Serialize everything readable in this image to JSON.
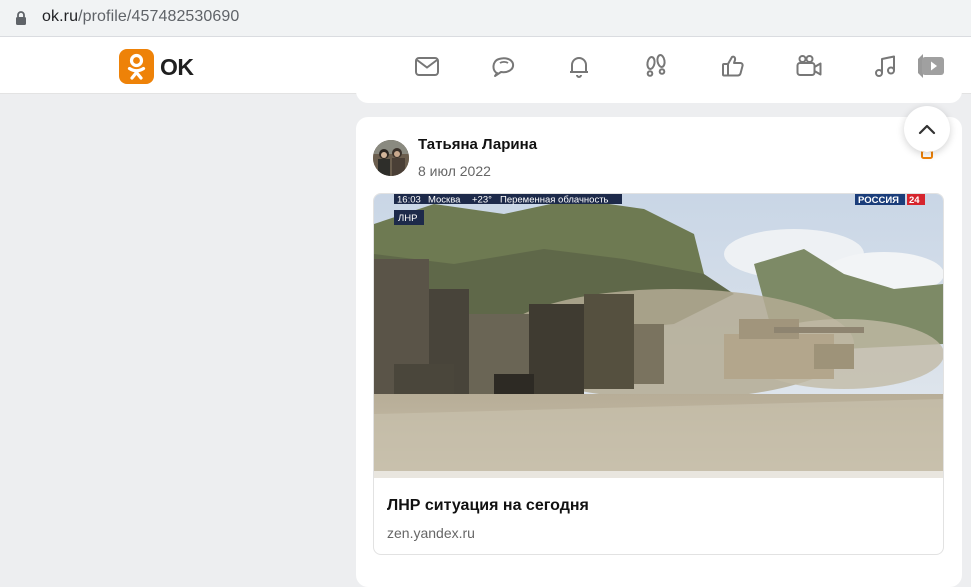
{
  "browser": {
    "url_host": "ok.ru",
    "url_path": "/profile/457482530690"
  },
  "logo": {
    "text": "OK",
    "brand_color": "#ee8208"
  },
  "nav": {
    "icons": [
      "messages-icon",
      "discussions-icon",
      "notifications-icon",
      "guests-icon",
      "events-icon",
      "video-calls-icon",
      "music-icon",
      "video-icon"
    ]
  },
  "post": {
    "author": "Татьяна Ларина",
    "date": "8 июл 2022",
    "link": {
      "title": "ЛНР ситуация на сегодня",
      "domain": "zen.yandex.ru",
      "thumbnail": {
        "ticker_time": "16:03",
        "ticker_city": "Москва",
        "ticker_temp": "+23°",
        "ticker_weather": "Переменная облачность",
        "channel": "РОССИЯ",
        "channel_number": "24",
        "region_tag": "ЛНР"
      }
    }
  },
  "colors": {
    "page_bg": "#edeef0",
    "card_bg": "#ffffff",
    "accent": "#ee8208"
  }
}
